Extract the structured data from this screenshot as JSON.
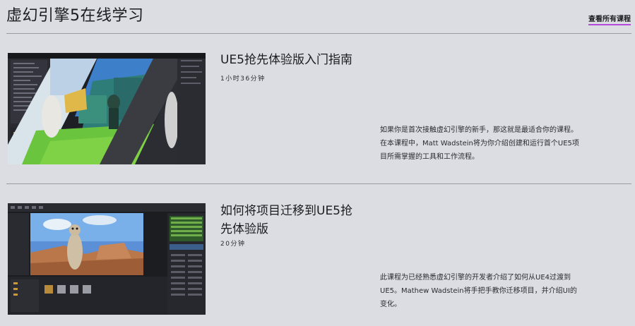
{
  "header": {
    "title": "虚幻引擎5在线学习",
    "view_all_label": "查看所有课程"
  },
  "courses": [
    {
      "title": "UE5抢先体验版入门指南",
      "duration": "1小时36分钟",
      "description": "如果你是首次接触虚幻引擎的新手，那这就是最适合你的课程。在本课程中，Matt Wadstein将为你介绍创建和运行首个UE5项目所需掌握的工具和工作流程。"
    },
    {
      "title": "如何将项目迁移到UE5抢先体验版",
      "duration": "20分钟",
      "description": "此课程为已经熟悉虚幻引擎的开发者介绍了如何从UE4过渡到UE5。Mathew Wadstein将手把手教你迁移项目，并介绍UI的变化。"
    }
  ],
  "colors": {
    "background": "#dcdde2",
    "accent_underline": "#b34bd8",
    "divider": "#9b9ca3"
  }
}
